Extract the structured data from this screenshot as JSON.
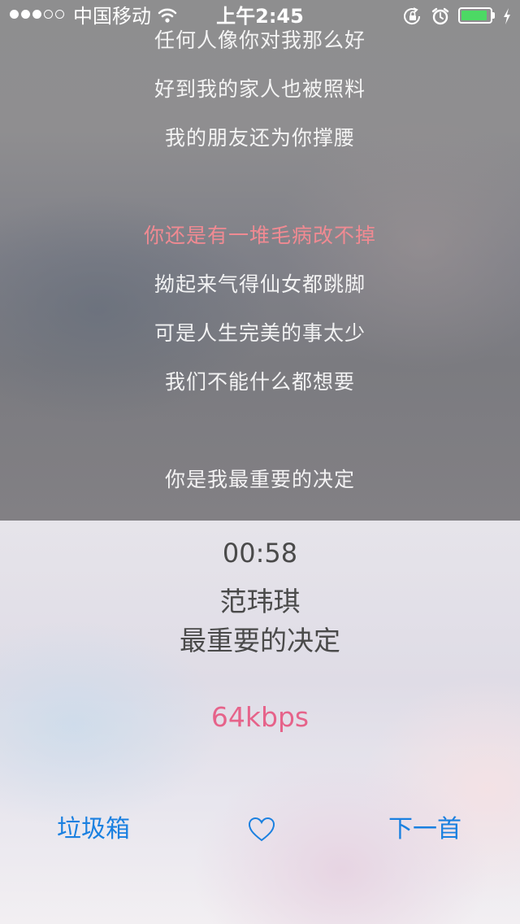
{
  "status_bar": {
    "signal_bars_filled": 3,
    "signal_bars_total": 5,
    "carrier": "中国移动",
    "time": "上午2:45",
    "battery_level": 0.9,
    "icons": [
      "wifi-icon",
      "rotation-lock-icon",
      "alarm-icon",
      "battery-icon",
      "charging-icon"
    ]
  },
  "lyrics": {
    "lines": [
      "任何人像你对我那么好",
      "好到我的家人也被照料",
      "我的朋友还为你撑腰",
      "你还是有一堆毛病改不掉",
      "拗起来气得仙女都跳脚",
      "可是人生完美的事太少",
      "我们不能什么都想要",
      "你是我最重要的决定"
    ],
    "current_line": "你还是有一堆毛病改不掉",
    "highlight_color": "#f08a92"
  },
  "player": {
    "elapsed_time": "00:58",
    "artist": "范玮琪",
    "title": "最重要的决定",
    "bitrate": "64kbps",
    "trash_label": "垃圾箱",
    "like_icon": "heart-outline-icon",
    "next_label": "下一首",
    "accent_color": "#1a80e0",
    "bitrate_color": "#e6638a"
  }
}
